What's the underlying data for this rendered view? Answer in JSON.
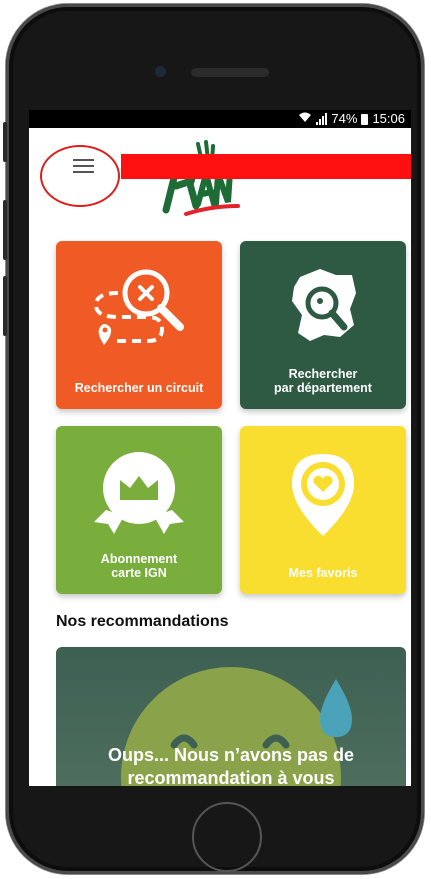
{
  "status_bar": {
    "battery": "74%",
    "time": "15:06"
  },
  "header": {
    "menu_icon": "hamburger-menu-icon",
    "logo_icon": "rando-logo-icon"
  },
  "tiles": [
    {
      "label": "Rechercher un circuit",
      "icon": "search-route-icon",
      "color": "#f05a24"
    },
    {
      "label": "Rechercher\npar département",
      "icon": "france-map-search-icon",
      "color": "#2e5a43"
    },
    {
      "label": "Abonnement\ncarte IGN",
      "icon": "crown-badge-icon",
      "color": "#79ad3c"
    },
    {
      "label": "Mes favoris",
      "icon": "heart-pin-icon",
      "color": "#f9dd2f"
    }
  ],
  "recommendations": {
    "title": "Nos recommandations",
    "message": "Oups... Nous n’avons pas de\nrecommandation à vous"
  }
}
